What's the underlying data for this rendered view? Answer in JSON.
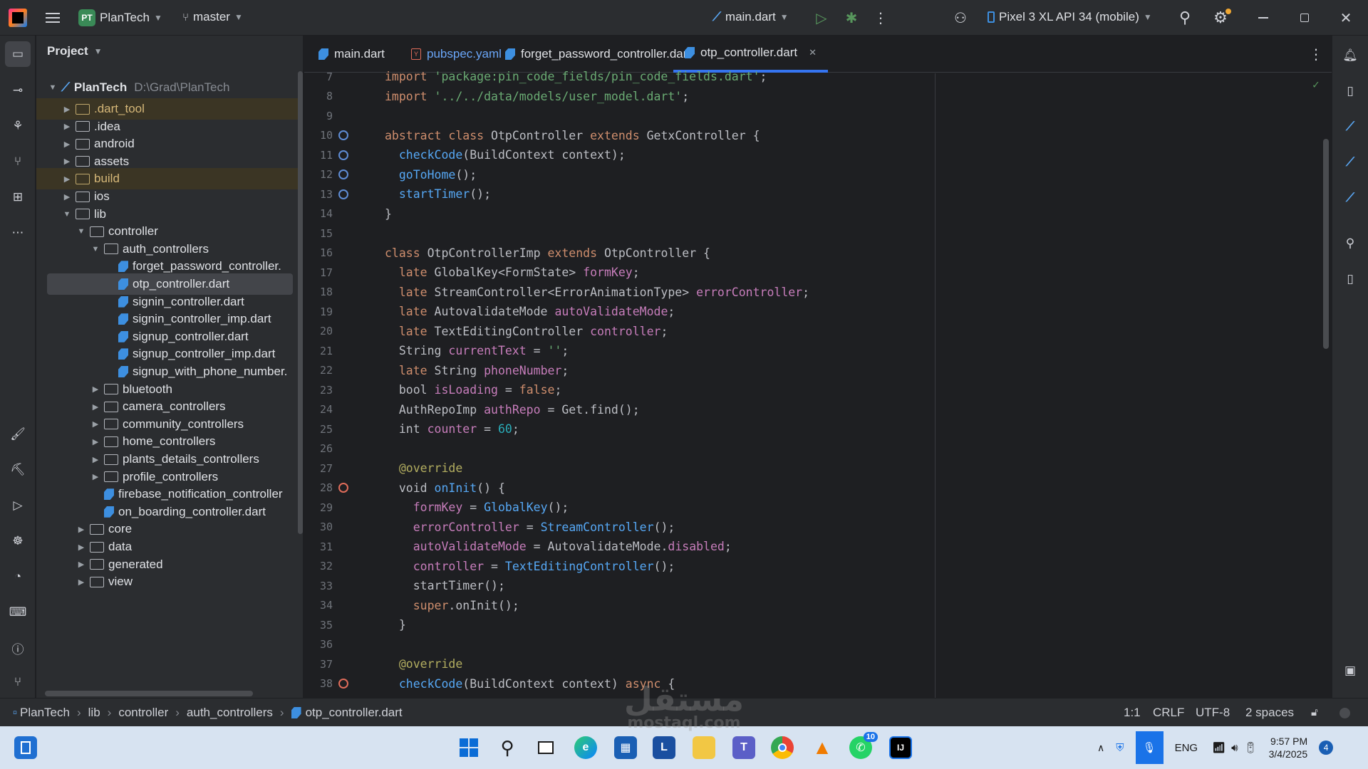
{
  "titlebar": {
    "project_badge": "PT",
    "project_name": "PlanTech",
    "branch": "master",
    "run_config": "main.dart",
    "device": "Pixel 3 XL API 34 (mobile)"
  },
  "project_panel": {
    "title": "Project",
    "root": {
      "name": "PlanTech",
      "path": "D:\\Grad\\PlanTech"
    },
    "items": [
      {
        "label": ".dart_tool",
        "type": "folder",
        "depth": 1,
        "expanded": false,
        "excluded": true
      },
      {
        "label": ".idea",
        "type": "folder",
        "depth": 1,
        "expanded": false,
        "excluded": false
      },
      {
        "label": "android",
        "type": "folder",
        "depth": 1,
        "expanded": false,
        "excluded": false
      },
      {
        "label": "assets",
        "type": "folder",
        "depth": 1,
        "expanded": false,
        "excluded": false
      },
      {
        "label": "build",
        "type": "folder",
        "depth": 1,
        "expanded": false,
        "excluded": true
      },
      {
        "label": "ios",
        "type": "folder",
        "depth": 1,
        "expanded": false,
        "excluded": false
      },
      {
        "label": "lib",
        "type": "folder",
        "depth": 1,
        "expanded": true,
        "excluded": false
      },
      {
        "label": "controller",
        "type": "folder",
        "depth": 2,
        "expanded": true,
        "excluded": false
      },
      {
        "label": "auth_controllers",
        "type": "folder",
        "depth": 3,
        "expanded": true,
        "excluded": false
      },
      {
        "label": "forget_password_controller.",
        "type": "dart",
        "depth": 4
      },
      {
        "label": "otp_controller.dart",
        "type": "dart",
        "depth": 4,
        "selected": true
      },
      {
        "label": "signin_controller.dart",
        "type": "dart",
        "depth": 4
      },
      {
        "label": "signin_controller_imp.dart",
        "type": "dart",
        "depth": 4
      },
      {
        "label": "signup_controller.dart",
        "type": "dart",
        "depth": 4
      },
      {
        "label": "signup_controller_imp.dart",
        "type": "dart",
        "depth": 4
      },
      {
        "label": "signup_with_phone_number.",
        "type": "dart",
        "depth": 4
      },
      {
        "label": "bluetooth",
        "type": "folder",
        "depth": 3,
        "expanded": false
      },
      {
        "label": "camera_controllers",
        "type": "folder",
        "depth": 3,
        "expanded": false
      },
      {
        "label": "community_controllers",
        "type": "folder",
        "depth": 3,
        "expanded": false
      },
      {
        "label": "home_controllers",
        "type": "folder",
        "depth": 3,
        "expanded": false
      },
      {
        "label": "plants_details_controllers",
        "type": "folder",
        "depth": 3,
        "expanded": false
      },
      {
        "label": "profile_controllers",
        "type": "folder",
        "depth": 3,
        "expanded": false
      },
      {
        "label": "firebase_notification_controller",
        "type": "dart",
        "depth": 3
      },
      {
        "label": "on_boarding_controller.dart",
        "type": "dart",
        "depth": 3
      },
      {
        "label": "core",
        "type": "folder",
        "depth": 2,
        "expanded": false
      },
      {
        "label": "data",
        "type": "folder",
        "depth": 2,
        "expanded": false
      },
      {
        "label": "generated",
        "type": "folder",
        "depth": 2,
        "expanded": false
      },
      {
        "label": "view",
        "type": "folder",
        "depth": 2,
        "expanded": false
      }
    ]
  },
  "tabs": [
    {
      "label": "main.dart",
      "icon": "dart-icon",
      "active": false
    },
    {
      "label": "pubspec.yaml",
      "icon": "yaml-icon",
      "active": false
    },
    {
      "label": "forget_password_controller.dart",
      "icon": "dart-icon",
      "active": false
    },
    {
      "label": "otp_controller.dart",
      "icon": "dart-icon",
      "active": true
    }
  ],
  "editor": {
    "lines": [
      {
        "n": "7",
        "gutter": "",
        "tokens": [
          [
            "k",
            "import "
          ],
          [
            "s",
            "'package:pin_code_fields/pin_code_fields.dart'"
          ],
          [
            "p",
            ";"
          ]
        ]
      },
      {
        "n": "8",
        "gutter": "",
        "tokens": [
          [
            "k",
            "import "
          ],
          [
            "s",
            "'../../data/models/user_model.dart'"
          ],
          [
            "p",
            ";"
          ]
        ]
      },
      {
        "n": "9",
        "gutter": "",
        "tokens": []
      },
      {
        "n": "10",
        "gutter": "impl",
        "tokens": [
          [
            "k",
            "abstract class "
          ],
          [
            "p",
            "OtpController "
          ],
          [
            "k",
            "extends "
          ],
          [
            "p",
            "GetxController {"
          ]
        ]
      },
      {
        "n": "11",
        "gutter": "impl",
        "tokens": [
          [
            "p",
            "  "
          ],
          [
            "f",
            "checkCode"
          ],
          [
            "p",
            "(BuildContext context);"
          ]
        ]
      },
      {
        "n": "12",
        "gutter": "impl",
        "tokens": [
          [
            "p",
            "  "
          ],
          [
            "f",
            "goToHome"
          ],
          [
            "p",
            "();"
          ]
        ]
      },
      {
        "n": "13",
        "gutter": "impl",
        "tokens": [
          [
            "p",
            "  "
          ],
          [
            "f",
            "startTimer"
          ],
          [
            "p",
            "();"
          ]
        ]
      },
      {
        "n": "14",
        "gutter": "",
        "tokens": [
          [
            "p",
            "}"
          ]
        ]
      },
      {
        "n": "15",
        "gutter": "",
        "tokens": []
      },
      {
        "n": "16",
        "gutter": "",
        "tokens": [
          [
            "k",
            "class "
          ],
          [
            "p",
            "OtpControllerImp "
          ],
          [
            "k",
            "extends "
          ],
          [
            "p",
            "OtpController {"
          ]
        ]
      },
      {
        "n": "17",
        "gutter": "",
        "tokens": [
          [
            "p",
            "  "
          ],
          [
            "k",
            "late "
          ],
          [
            "p",
            "GlobalKey<FormState> "
          ],
          [
            "v",
            "formKey"
          ],
          [
            "p",
            ";"
          ]
        ]
      },
      {
        "n": "18",
        "gutter": "",
        "tokens": [
          [
            "p",
            "  "
          ],
          [
            "k",
            "late "
          ],
          [
            "p",
            "StreamController<ErrorAnimationType> "
          ],
          [
            "v",
            "errorController"
          ],
          [
            "p",
            ";"
          ]
        ]
      },
      {
        "n": "19",
        "gutter": "",
        "tokens": [
          [
            "p",
            "  "
          ],
          [
            "k",
            "late "
          ],
          [
            "p",
            "AutovalidateMode "
          ],
          [
            "v",
            "autoValidateMode"
          ],
          [
            "p",
            ";"
          ]
        ]
      },
      {
        "n": "20",
        "gutter": "",
        "tokens": [
          [
            "p",
            "  "
          ],
          [
            "k",
            "late "
          ],
          [
            "p",
            "TextEditingController "
          ],
          [
            "v",
            "controller"
          ],
          [
            "p",
            ";"
          ]
        ]
      },
      {
        "n": "21",
        "gutter": "",
        "tokens": [
          [
            "p",
            "  String "
          ],
          [
            "v",
            "currentText"
          ],
          [
            "p",
            " = "
          ],
          [
            "s",
            "''"
          ],
          [
            "p",
            ";"
          ]
        ]
      },
      {
        "n": "22",
        "gutter": "",
        "tokens": [
          [
            "p",
            "  "
          ],
          [
            "k",
            "late "
          ],
          [
            "p",
            "String "
          ],
          [
            "v",
            "phoneNumber"
          ],
          [
            "p",
            ";"
          ]
        ]
      },
      {
        "n": "23",
        "gutter": "",
        "tokens": [
          [
            "p",
            "  bool "
          ],
          [
            "v",
            "isLoading"
          ],
          [
            "p",
            " = "
          ],
          [
            "k",
            "false"
          ],
          [
            "p",
            ";"
          ]
        ]
      },
      {
        "n": "24",
        "gutter": "",
        "tokens": [
          [
            "p",
            "  AuthRepoImp "
          ],
          [
            "v",
            "authRepo"
          ],
          [
            "p",
            " = Get.find();"
          ]
        ]
      },
      {
        "n": "25",
        "gutter": "",
        "tokens": [
          [
            "p",
            "  int "
          ],
          [
            "v",
            "counter"
          ],
          [
            "p",
            " = "
          ],
          [
            "n",
            "60"
          ],
          [
            "p",
            ";"
          ]
        ]
      },
      {
        "n": "26",
        "gutter": "",
        "tokens": []
      },
      {
        "n": "27",
        "gutter": "",
        "tokens": [
          [
            "p",
            "  "
          ],
          [
            "a",
            "@override"
          ]
        ]
      },
      {
        "n": "28",
        "gutter": "override",
        "tokens": [
          [
            "p",
            "  void "
          ],
          [
            "f",
            "onInit"
          ],
          [
            "p",
            "() {"
          ]
        ]
      },
      {
        "n": "29",
        "gutter": "",
        "tokens": [
          [
            "p",
            "    "
          ],
          [
            "v",
            "formKey"
          ],
          [
            "p",
            " = "
          ],
          [
            "f",
            "GlobalKey"
          ],
          [
            "p",
            "();"
          ]
        ]
      },
      {
        "n": "30",
        "gutter": "",
        "tokens": [
          [
            "p",
            "    "
          ],
          [
            "v",
            "errorController"
          ],
          [
            "p",
            " = "
          ],
          [
            "f",
            "StreamController"
          ],
          [
            "p",
            "();"
          ]
        ]
      },
      {
        "n": "31",
        "gutter": "",
        "tokens": [
          [
            "p",
            "    "
          ],
          [
            "v",
            "autoValidateMode"
          ],
          [
            "p",
            " = AutovalidateMode."
          ],
          [
            "v",
            "disabled"
          ],
          [
            "p",
            ";"
          ]
        ]
      },
      {
        "n": "32",
        "gutter": "",
        "tokens": [
          [
            "p",
            "    "
          ],
          [
            "v",
            "controller"
          ],
          [
            "p",
            " = "
          ],
          [
            "f",
            "TextEditingController"
          ],
          [
            "p",
            "();"
          ]
        ]
      },
      {
        "n": "33",
        "gutter": "",
        "tokens": [
          [
            "p",
            "    startTimer();"
          ]
        ]
      },
      {
        "n": "34",
        "gutter": "",
        "tokens": [
          [
            "p",
            "    "
          ],
          [
            "k",
            "super"
          ],
          [
            "p",
            ".onInit();"
          ]
        ]
      },
      {
        "n": "35",
        "gutter": "",
        "tokens": [
          [
            "p",
            "  }"
          ]
        ]
      },
      {
        "n": "36",
        "gutter": "",
        "tokens": []
      },
      {
        "n": "37",
        "gutter": "",
        "tokens": [
          [
            "p",
            "  "
          ],
          [
            "a",
            "@override"
          ]
        ]
      },
      {
        "n": "38",
        "gutter": "override",
        "tokens": [
          [
            "p",
            "  "
          ],
          [
            "f",
            "checkCode"
          ],
          [
            "p",
            "(BuildContext context) "
          ],
          [
            "k",
            "async "
          ],
          [
            "p",
            "{"
          ]
        ]
      }
    ]
  },
  "statusbar": {
    "breadcrumbs": [
      "PlanTech",
      "lib",
      "controller",
      "auth_controllers",
      "otp_controller.dart"
    ],
    "position": "1:1",
    "line_ending": "CRLF",
    "encoding": "UTF-8",
    "indent": "2 spaces"
  },
  "taskbar": {
    "language": "ENG",
    "time": "9:57 PM",
    "date": "3/4/2025",
    "notification_count": "4",
    "whatsapp_badge": "10"
  },
  "watermark": {
    "text": "مستقل",
    "sub": "mostaql.com"
  },
  "colors": {
    "accent": "#3574f0",
    "editor_bg": "#1e1f22",
    "panel_bg": "#2b2d30",
    "taskbar_bg": "#d7e3f1"
  }
}
